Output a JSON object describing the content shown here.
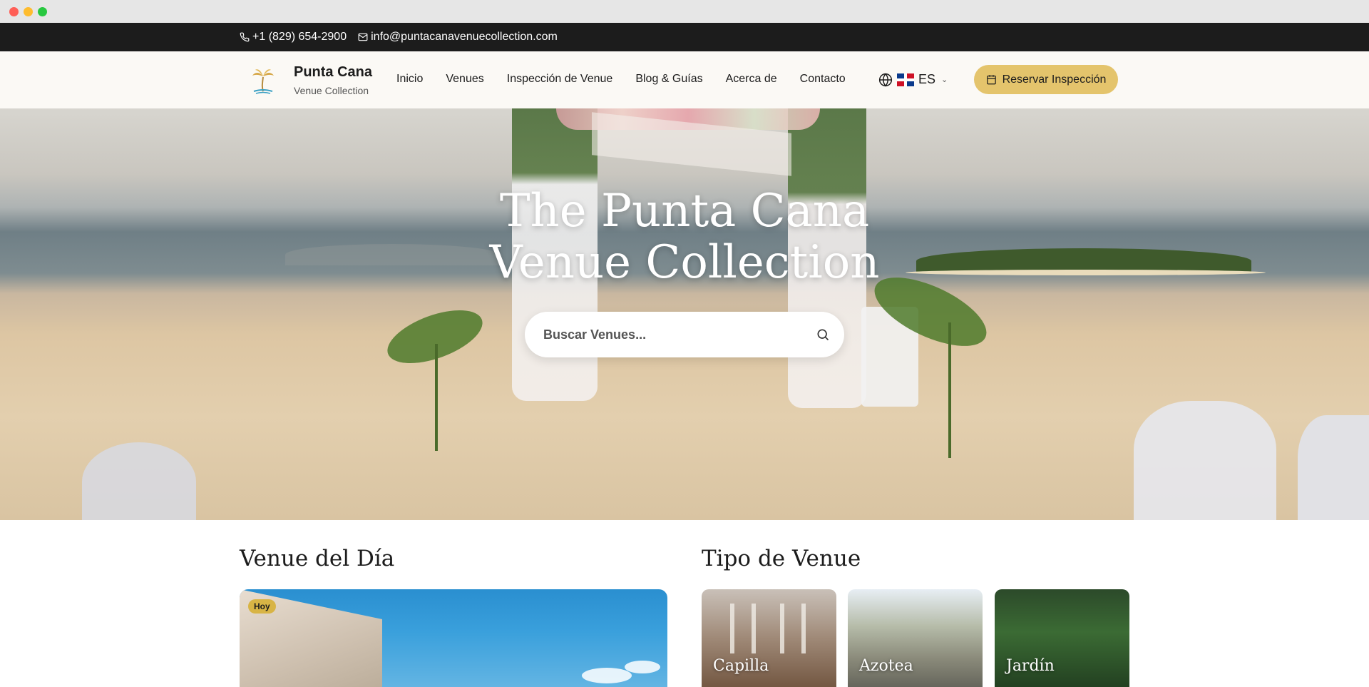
{
  "topbar": {
    "phone": "+1 (829) 654-2900",
    "email": "info@puntacanavenuecollection.com"
  },
  "brand": {
    "name": "Punta Cana",
    "subtitle": "Venue Collection"
  },
  "menu": {
    "items": [
      "Inicio",
      "Venues",
      "Inspección de Venue",
      "Blog & Guías",
      "Acerca de",
      "Contacto"
    ]
  },
  "language": {
    "code": "ES"
  },
  "cta": {
    "label": "Reservar Inspección"
  },
  "hero": {
    "title_line1": "The Punta Cana",
    "title_line2": "Venue Collection",
    "search_placeholder": "Buscar Venues..."
  },
  "sections": {
    "venue_of_day": {
      "title": "Venue del Día",
      "badge": "Hoy"
    },
    "venue_types": {
      "title": "Tipo de Venue",
      "items": [
        "Capilla",
        "Azotea",
        "Jardín"
      ]
    }
  },
  "colors": {
    "topbar_bg": "#1c1c1c",
    "nav_bg": "#fbf9f5",
    "accent_gold": "#e4c46c"
  }
}
